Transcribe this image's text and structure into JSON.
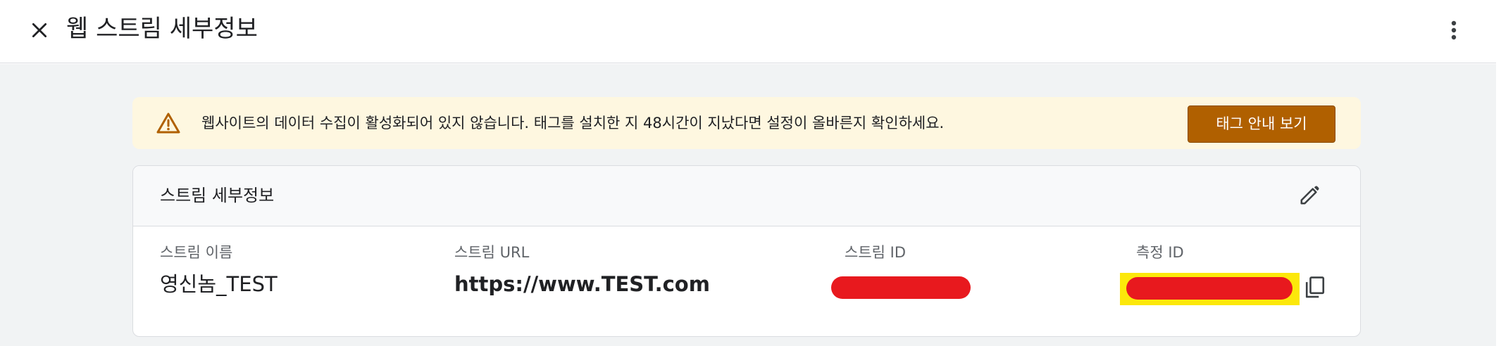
{
  "header": {
    "title": "웹 스트림 세부정보"
  },
  "banner": {
    "message": "웹사이트의 데이터 수집이 활성화되어 있지 않습니다. 태그를 설치한 지 48시간이 지났다면 설정이 올바른지 확인하세요.",
    "button_label": "태그 안내 보기"
  },
  "stream_details": {
    "title": "스트림 세부정보",
    "fields": [
      {
        "label": "스트림 이름",
        "value": "영신놈_TEST"
      },
      {
        "label": "스트림 URL",
        "value": "https://www.TEST.com"
      },
      {
        "label": "스트림 ID",
        "value": ""
      },
      {
        "label": "측정 ID",
        "value": ""
      }
    ]
  },
  "icons": {
    "close": "close-icon",
    "more": "more-vert-icon",
    "warning": "warning-icon",
    "edit": "pencil-icon",
    "copy": "copy-icon"
  },
  "colors": {
    "banner_bg": "#fef7e0",
    "banner_button": "#b06000",
    "warning": "#b06000",
    "redaction": "#e8191e",
    "highlight": "#fce80a"
  }
}
